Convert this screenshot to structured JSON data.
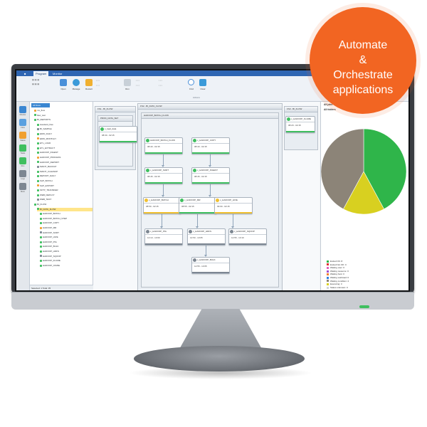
{
  "badge": {
    "lines": [
      "Automate",
      "&",
      "Orchestrate",
      "applications"
    ],
    "color": "#f26522"
  },
  "ribbon": {
    "tabs": [
      "Program",
      "Monitor"
    ],
    "buttons": [
      {
        "label": "Open",
        "icon": "folder-icon"
      },
      {
        "label": "Manage",
        "icon": "manage-icon"
      },
      {
        "label": "Restart",
        "icon": "restart-icon"
      },
      {
        "label": "Run",
        "icon": "run-icon"
      },
      {
        "label": "Find",
        "icon": "find-icon"
      },
      {
        "label": "Clear",
        "icon": "clear-icon"
      }
    ],
    "group_labels": [
      "",
      "",
      "Actions"
    ]
  },
  "leftbar": {
    "items": [
      {
        "label": "Monitor",
        "icon": "monitor-icon",
        "color": "#3a86d1"
      },
      {
        "label": "Flow",
        "icon": "flow-icon",
        "color": "#5aa0e0"
      },
      {
        "label": "Status",
        "icon": "status-icon",
        "color": "#f0a030"
      },
      {
        "label": "Tasks",
        "icon": "tasks-icon",
        "color": "#3fbf5f"
      },
      {
        "label": "Run",
        "icon": "run-icon",
        "color": "#3fbf5f"
      },
      {
        "label": "Logs",
        "icon": "logs-icon",
        "color": "#7d8792"
      },
      {
        "label": "More",
        "icon": "more-icon",
        "color": "#7d8792"
      }
    ]
  },
  "tree": {
    "tab_label": "All flows",
    "rows": [
      {
        "label": "mx_flow",
        "indent": 1,
        "color": "#f0a030"
      },
      {
        "label": "flow_test",
        "indent": 1,
        "color": "#3fbf5f"
      },
      {
        "label": "BI_REPORTS",
        "indent": 1,
        "color": "#3fbf5f"
      },
      {
        "label": "standard_flow",
        "indent": 2,
        "color": "#3fbf5f"
      },
      {
        "label": "BI_SAMPLE",
        "indent": 2,
        "color": "#7d8792"
      },
      {
        "label": "EDW_DAILY",
        "indent": 2,
        "color": "#3fbf5f"
      },
      {
        "label": "EDW_MONTHLY",
        "indent": 2,
        "color": "#f0a030"
      },
      {
        "label": "ETL_LOAD",
        "indent": 2,
        "color": "#3fbf5f"
      },
      {
        "label": "ETL_EXTRACT",
        "indent": 2,
        "color": "#3fbf5f"
      },
      {
        "label": "HADOOP_INGEST",
        "indent": 2,
        "color": "#3fbf5f"
      },
      {
        "label": "HADOOP_PROCESS",
        "indent": 2,
        "color": "#f0a030"
      },
      {
        "label": "HADOOP_REPORT",
        "indent": 2,
        "color": "#3fbf5f"
      },
      {
        "label": "MAINT_BACKUP",
        "indent": 2,
        "color": "#7d8792"
      },
      {
        "label": "MAINT_CLEANUP",
        "indent": 2,
        "color": "#3fbf5f"
      },
      {
        "label": "REPORT_DAILY",
        "indent": 2,
        "color": "#3fbf5f"
      },
      {
        "label": "SAP_BATCH",
        "indent": 2,
        "color": "#3fbf5f"
      },
      {
        "label": "SAP_EXPORT",
        "indent": 2,
        "color": "#f0a030"
      },
      {
        "label": "SFTP_TRANSFER",
        "indent": 2,
        "color": "#3fbf5f"
      },
      {
        "label": "WEB_DEPLOY",
        "indent": 2,
        "color": "#3fbf5f"
      },
      {
        "label": "WEB_TEST",
        "indent": 2,
        "color": "#7d8792"
      },
      {
        "label": "BI_FLOW",
        "indent": 1,
        "color": "#3fbf5f"
      },
      {
        "label": "BI_DATA_FLOW",
        "indent": 2,
        "color": "#3fbf5f",
        "selected": true
      },
      {
        "label": "HADOOP_BATCH",
        "indent": 3,
        "color": "#3fbf5f"
      },
      {
        "label": "HADOOP_BATCH_STEP",
        "indent": 3,
        "color": "#3fbf5f"
      },
      {
        "label": "HADOOP_COPY",
        "indent": 3,
        "color": "#3fbf5f"
      },
      {
        "label": "HADOOP_MR",
        "indent": 3,
        "color": "#f0a030"
      },
      {
        "label": "HADOOP_SORT",
        "indent": 3,
        "color": "#7d8792"
      },
      {
        "label": "HADOOP_HIVE",
        "indent": 3,
        "color": "#3fbf5f"
      },
      {
        "label": "HADOOP_PIG",
        "indent": 3,
        "color": "#3fbf5f"
      },
      {
        "label": "HADOOP_BULK",
        "indent": 3,
        "color": "#3fbf5f"
      },
      {
        "label": "HADOOP_HDFS",
        "indent": 3,
        "color": "#3fbf5f"
      },
      {
        "label": "HADOOP_SQOOP",
        "indent": 3,
        "color": "#7d8792"
      },
      {
        "label": "HADOOP_FLUME",
        "indent": 3,
        "color": "#3fbf5f"
      },
      {
        "label": "HADOOP_OOZIE",
        "indent": 3,
        "color": "#3fbf5f"
      }
    ],
    "status_text": "Selected: 1 Total: 35"
  },
  "canvas": {
    "box1": {
      "title": "FS1 - BI_FLOW"
    },
    "box1_sub": {
      "title": "PROD_DATA_SET"
    },
    "box2": {
      "title": "FS2 - BI_DATA_FLOW"
    },
    "box2_sub": {
      "title": "HADOOP_BATCH_FLOW"
    },
    "box3": {
      "title": "FS3 - BI_FLOW"
    },
    "nodes": [
      {
        "title": "c_load_data",
        "time": "08:30 - 02:15",
        "status": "#3fbf5f"
      },
      {
        "title": "HADOOP_BATCH_FLOW",
        "time": "08:40 - 02:15",
        "status": "#3fbf5f"
      },
      {
        "title": "c_HADOOP_COPY",
        "time": "08:40 - 02:15",
        "status": "#3fbf5f"
      },
      {
        "title": "c_HADOOP_SORT",
        "time": "08:45 - 02:15",
        "status": "#3fbf5f"
      },
      {
        "title": "c_HADOOP_INGEST",
        "time": "08:45 - 02:15",
        "status": "#3fbf5f"
      },
      {
        "title": "c_HADOOP_BATCH",
        "time": "08:50 - 02:15",
        "status": "#f0c030"
      },
      {
        "title": "c_HADOOP_MR",
        "time": "08:55 - 02:15",
        "status": "#3fbf5f"
      },
      {
        "title": "c_HADOOP_HIVE",
        "time": "09:00 - 02:15",
        "status": "#f0c030"
      },
      {
        "title": "c_HADOOP_PIG",
        "time": "12:10 - 13:00",
        "status": "#7d8792"
      },
      {
        "title": "c_HADOOP_HDFS",
        "time": "12:50 - 13:05",
        "status": "#7d8792"
      },
      {
        "title": "c_HADOOP_SQOOP",
        "time": "12:55 - 13:10",
        "status": "#7d8792"
      },
      {
        "title": "c_HADOOP_BULK",
        "time": "12:55 - 13:05",
        "status": "#7d8792"
      },
      {
        "title": "c_HADOOP_FLUME",
        "time": "08:20 - 02:15",
        "status": "#3fbf5f"
      }
    ]
  },
  "right": {
    "heading1": "All jobs",
    "heading2": "All folders",
    "legend": [
      {
        "label": "Ended OK: 8",
        "color": "#2fb54a"
      },
      {
        "label": "Ended Not OK: 0",
        "color": "#e03030"
      },
      {
        "label": "Waiting user: 0",
        "color": "#e060c0"
      },
      {
        "label": "Waiting resource: 0",
        "color": "#a050d0"
      },
      {
        "label": "Waiting host: 0",
        "color": "#f08030"
      },
      {
        "label": "Waiting workload: 0",
        "color": "#3080e0"
      },
      {
        "label": "Waiting condition: 4",
        "color": "#8c8478"
      },
      {
        "label": "Executing: 3",
        "color": "#d8d020"
      },
      {
        "label": "Status unknown: 0",
        "color": "#cfd4da"
      }
    ]
  },
  "chart_data": {
    "type": "pie",
    "series": [
      {
        "name": "Ended OK",
        "value": 8,
        "color": "#2fb54a"
      },
      {
        "name": "Executing",
        "value": 3,
        "color": "#d8d020"
      },
      {
        "name": "Waiting condition",
        "value": 8,
        "color": "#8c8478"
      }
    ]
  }
}
